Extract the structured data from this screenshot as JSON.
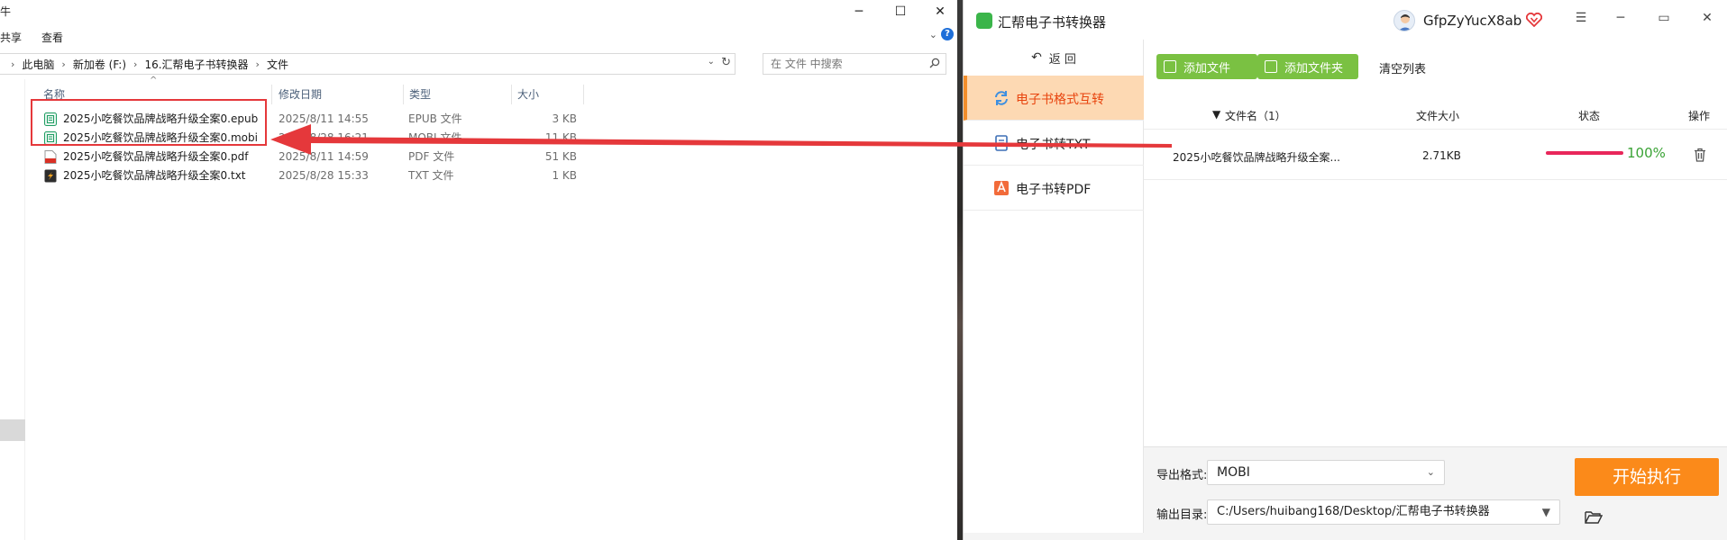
{
  "explorer": {
    "title_fragment": "牛",
    "ribbon": {
      "share_tab": "共享",
      "view_tab": "查看"
    },
    "breadcrumb": [
      "此电脑",
      "新加卷 (F:)",
      "16.汇帮电子书转换器",
      "文件"
    ],
    "search_placeholder": "在 文件 中搜索",
    "columns": {
      "name": "名称",
      "date": "修改日期",
      "type": "类型",
      "size": "大小"
    },
    "files": [
      {
        "name": "2025小吃餐饮品牌战略升级全案0.epub",
        "date": "2025/8/11 14:55",
        "type": "EPUB 文件",
        "size": "3 KB",
        "icon": "epub-icon"
      },
      {
        "name": "2025小吃餐饮品牌战略升级全案0.mobi",
        "date": "2025/8/28 16:21",
        "type": "MOBI 文件",
        "size": "11 KB",
        "icon": "mobi-icon"
      },
      {
        "name": "2025小吃餐饮品牌战略升级全案0.pdf",
        "date": "2025/8/11 14:59",
        "type": "PDF 文件",
        "size": "51 KB",
        "icon": "pdf-icon"
      },
      {
        "name": "2025小吃餐饮品牌战略升级全案0.txt",
        "date": "2025/8/28 15:33",
        "type": "TXT 文件",
        "size": "1 KB",
        "icon": "txt-icon"
      }
    ]
  },
  "app": {
    "title": "汇帮电子书转换器",
    "username": "GfpZyYucX8ab",
    "back_label": "返 回",
    "sidebar": [
      {
        "label": "电子书格式互转",
        "icon": "convert-icon",
        "active": true
      },
      {
        "label": "电子书转TXT",
        "icon": "txt-doc-icon",
        "active": false
      },
      {
        "label": "电子书转PDF",
        "icon": "pdf-doc-icon",
        "active": false
      }
    ],
    "toolbar": {
      "add_file": "添加文件",
      "add_folder": "添加文件夹",
      "clear_list": "清空列表"
    },
    "table": {
      "headers": {
        "name": "文件名（1）",
        "size": "文件大小",
        "status": "状态",
        "action": "操作"
      },
      "rows": [
        {
          "name": "2025小吃餐饮品牌战略升级全案...",
          "size": "2.71KB",
          "progress": 100,
          "progress_label": "100%"
        }
      ]
    },
    "export": {
      "format_label": "导出格式:",
      "format_value": "MOBI",
      "dir_label": "输出目录:",
      "dir_value": "C:/Users/huibang168/Desktop/汇帮电子书转换器"
    },
    "start_button": "开始执行"
  },
  "colors": {
    "accent_orange": "#fb8a1a",
    "active_tab_bg": "#fdd9b3",
    "active_tab_text": "#e8440e",
    "add_button_green": "#7ac142",
    "progress_red": "#e8275a",
    "progress_text_green": "#3aa335",
    "annotation_red": "#e5383b"
  }
}
